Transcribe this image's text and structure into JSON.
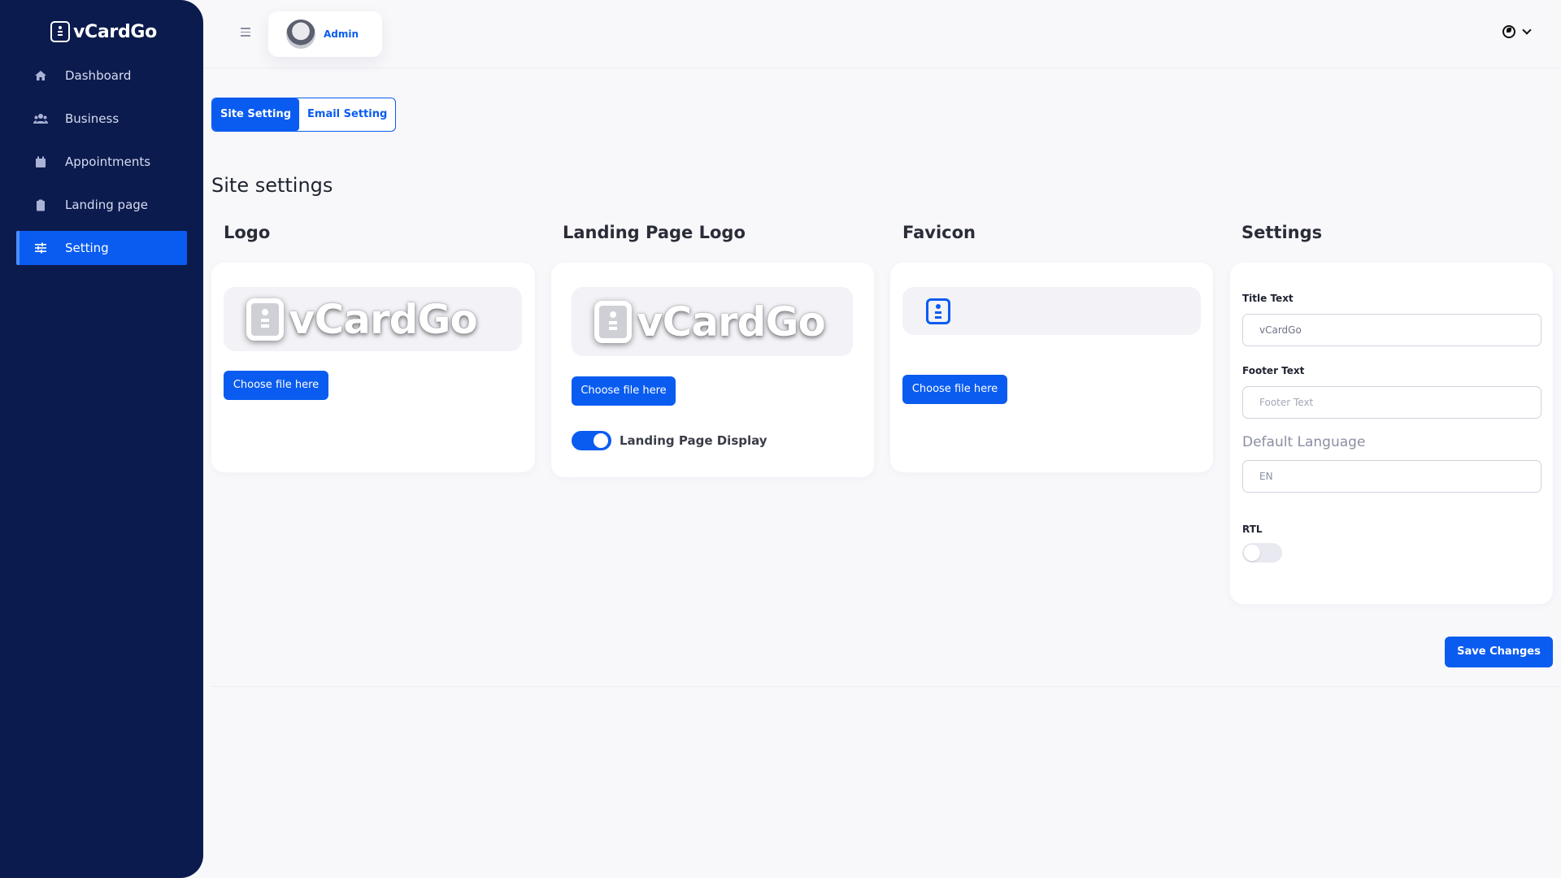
{
  "sidebar": {
    "brand": "vCardGo",
    "items": [
      {
        "label": "Dashboard",
        "icon": "home-icon"
      },
      {
        "label": "Business",
        "icon": "users-icon"
      },
      {
        "label": "Appointments",
        "icon": "calendar-icon"
      },
      {
        "label": "Landing page",
        "icon": "clipboard-icon"
      },
      {
        "label": "Setting",
        "icon": "sliders-icon",
        "active": true
      }
    ]
  },
  "topbar": {
    "user_name": "Admin",
    "language_icon": "globe-icon"
  },
  "tabs": [
    {
      "label": "Site Setting",
      "active": true
    },
    {
      "label": "Email Setting",
      "active": false
    }
  ],
  "page_title": "Site settings",
  "logo": {
    "title": "Logo",
    "preview_text": "vCardGo",
    "button": "Choose file here"
  },
  "landing_logo": {
    "title": "Landing Page Logo",
    "preview_text": "vCardGo",
    "button": "Choose file here",
    "toggle_label": "Landing Page Display",
    "toggle_on": true
  },
  "favicon": {
    "title": "Favicon",
    "button": "Choose file here"
  },
  "settings": {
    "title": "Settings",
    "title_text_label": "Title Text",
    "title_text_value": "vCardGo",
    "footer_text_label": "Footer Text",
    "footer_text_placeholder": "Footer Text",
    "default_language_label": "Default Language",
    "default_language_value": "EN",
    "rtl_label": "RTL",
    "rtl_on": false
  },
  "save_button": "Save Changes",
  "colors": {
    "sidebar_bg": "#0b1b4e",
    "accent": "#0a5cf0",
    "page_bg": "#f8f8fb"
  }
}
